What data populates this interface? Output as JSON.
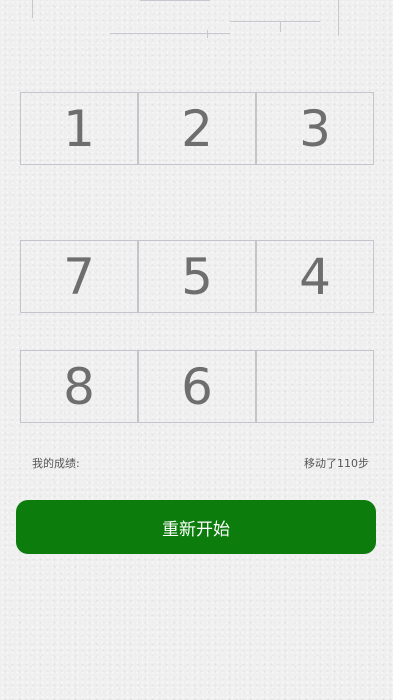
{
  "board": {
    "tiles": [
      "1",
      "2",
      "3",
      "7",
      "5",
      "4",
      "8",
      "6",
      ""
    ]
  },
  "status": {
    "score_label": "我的成绩:",
    "moves_text": "移动了110步"
  },
  "actions": {
    "restart_label": "重新开始"
  },
  "colors": {
    "accent": "#0c7d0c",
    "tile_text": "#6e6e6e",
    "tile_border": "#c4c4cc"
  }
}
